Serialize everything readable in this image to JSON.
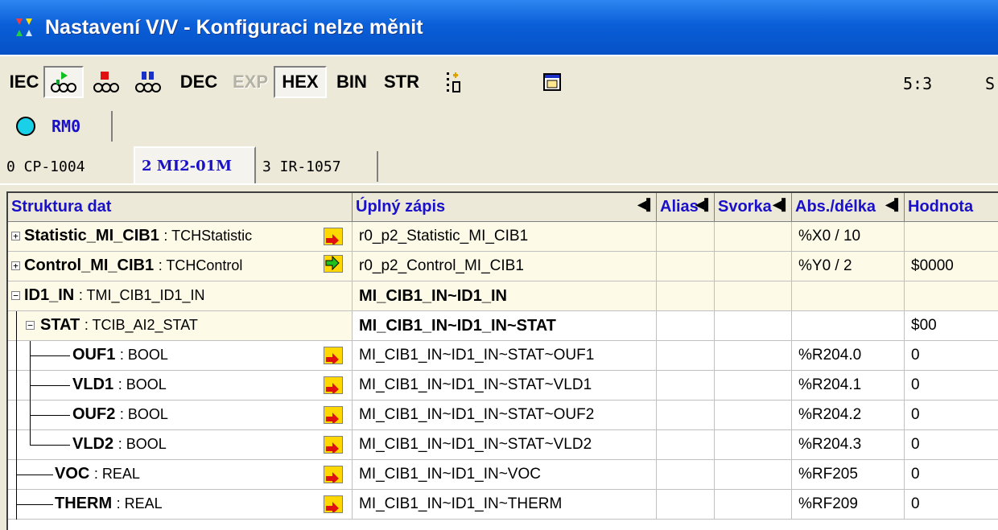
{
  "window": {
    "title": "Nastavení V/V - Konfiguraci nelze měnit",
    "title_icon": "app-io-icon"
  },
  "toolbar": {
    "iec": "IEC",
    "dec": "DEC",
    "exp": "EXP",
    "hex": "HEX",
    "bin": "BIN",
    "str": "STR",
    "position": "5:3",
    "status": "S"
  },
  "station_tab": {
    "label": "RM0"
  },
  "module_tabs": [
    {
      "label": "0 CP-1004"
    },
    {
      "label": "2 MI2-01M"
    },
    {
      "label": "3 IR-1057"
    }
  ],
  "columns": {
    "structure": "Struktura dat",
    "full": "Úplný zápis",
    "alias": "Alias",
    "terminal": "Svorka",
    "abs": "Abs./délka",
    "value": "Hodnota"
  },
  "rows": [
    {
      "name": "Statistic_MI_CIB1",
      "type": ": TCHStatistic",
      "full": "r0_p2_Statistic_MI_CIB1",
      "alias": "",
      "terminal": "",
      "abs": "%X0 / 10",
      "value": ""
    },
    {
      "name": "Control_MI_CIB1",
      "type": ": TCHControl",
      "full": "r0_p2_Control_MI_CIB1",
      "alias": "",
      "terminal": "",
      "abs": "%Y0 / 2",
      "value": "$0000"
    },
    {
      "name": "ID1_IN",
      "type": ": TMI_CIB1_ID1_IN",
      "full": "MI_CIB1_IN~ID1_IN",
      "alias": "",
      "terminal": "",
      "abs": "",
      "value": ""
    },
    {
      "name": "STAT",
      "type": ": TCIB_AI2_STAT",
      "full": "MI_CIB1_IN~ID1_IN~STAT",
      "alias": "",
      "terminal": "",
      "abs": "",
      "value": "$00"
    },
    {
      "name": "OUF1",
      "type": ": BOOL",
      "full": "MI_CIB1_IN~ID1_IN~STAT~OUF1",
      "alias": "",
      "terminal": "",
      "abs": "%R204.0",
      "value": "0"
    },
    {
      "name": "VLD1",
      "type": ": BOOL",
      "full": "MI_CIB1_IN~ID1_IN~STAT~VLD1",
      "alias": "",
      "terminal": "",
      "abs": "%R204.1",
      "value": "0"
    },
    {
      "name": "OUF2",
      "type": ": BOOL",
      "full": "MI_CIB1_IN~ID1_IN~STAT~OUF2",
      "alias": "",
      "terminal": "",
      "abs": "%R204.2",
      "value": "0"
    },
    {
      "name": "VLD2",
      "type": ": BOOL",
      "full": "MI_CIB1_IN~ID1_IN~STAT~VLD2",
      "alias": "",
      "terminal": "",
      "abs": "%R204.3",
      "value": "0"
    },
    {
      "name": "VOC",
      "type": ": REAL",
      "full": "MI_CIB1_IN~ID1_IN~VOC",
      "alias": "",
      "terminal": "",
      "abs": "%RF205",
      "value": "0"
    },
    {
      "name": "THERM",
      "type": ": REAL",
      "full": "MI_CIB1_IN~ID1_IN~THERM",
      "alias": "",
      "terminal": "",
      "abs": "%RF209",
      "value": "0"
    }
  ]
}
